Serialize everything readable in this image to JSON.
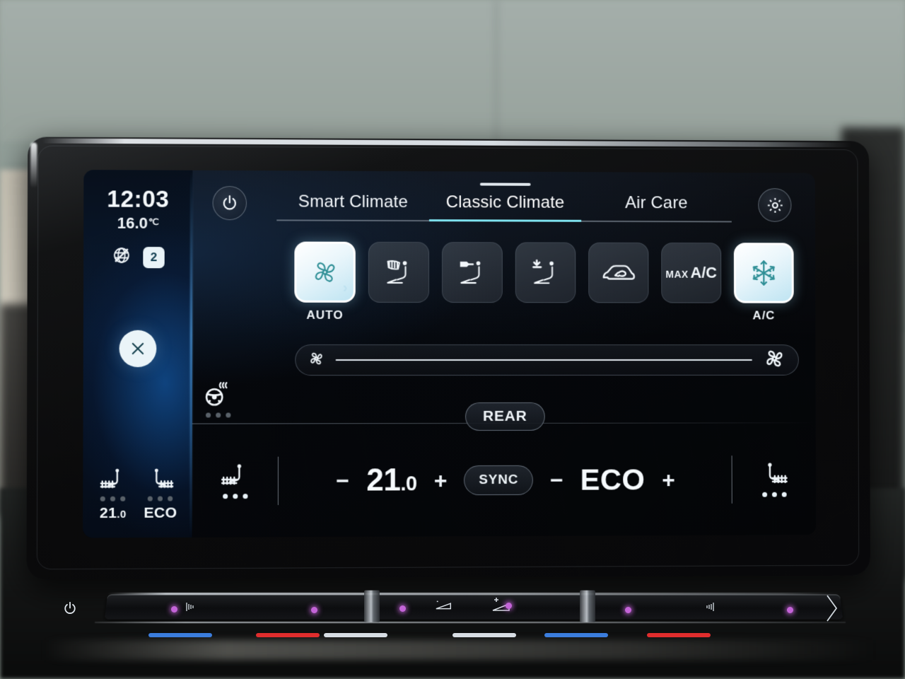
{
  "sidebar": {
    "clock": "12:03",
    "outside_temp": "16.0",
    "temp_unit": "℃",
    "connectivity_icon": "globe-no-connection-icon",
    "profile_badge": "2",
    "close_icon": "close-icon",
    "seats": [
      {
        "icon": "seat-heater-left-icon",
        "label": "21.0",
        "level_dots": 3,
        "active_dots": 0
      },
      {
        "icon": "seat-heater-right-icon",
        "label": "ECO",
        "level_dots": 3,
        "active_dots": 0
      }
    ]
  },
  "topbar": {
    "power_icon": "power-icon",
    "settings_icon": "gear-icon",
    "tabs": [
      {
        "label": "Smart Climate",
        "active": false
      },
      {
        "label": "Classic Climate",
        "active": true
      },
      {
        "label": "Air Care",
        "active": false
      }
    ]
  },
  "modes": [
    {
      "id": "auto",
      "icon": "fan-auto-icon",
      "label": "AUTO",
      "active": true,
      "chevron": "›"
    },
    {
      "id": "defrost",
      "icon": "windshield-defrost-icon",
      "label": "",
      "active": false
    },
    {
      "id": "face-vent",
      "icon": "seat-face-vent-icon",
      "label": "",
      "active": false
    },
    {
      "id": "floor-vent",
      "icon": "seat-floor-vent-icon",
      "label": "",
      "active": false
    },
    {
      "id": "recirculate",
      "icon": "air-recirculation-icon",
      "label": "",
      "active": false
    },
    {
      "id": "max-ac",
      "icon": "max-ac-text",
      "label": "",
      "active": false,
      "text_small": "MAX",
      "text_large": "A/C"
    },
    {
      "id": "ac",
      "icon": "snowflake-icon",
      "label": "A/C",
      "active": true
    }
  ],
  "fan_slider": {
    "icon_low": "fan-small-icon",
    "icon_high": "fan-large-icon",
    "value_percent": 100
  },
  "bottom": {
    "rear_label": "REAR",
    "sync_label": "SYNC",
    "minus": "−",
    "plus": "+",
    "driver_temp": {
      "whole": "21",
      "decimal": ".0"
    },
    "passenger_mode": "ECO",
    "seat_left": {
      "icon": "seat-heater-left-icon",
      "level_dots": 3,
      "active_dots": 0
    },
    "seat_right": {
      "icon": "seat-heater-right-icon",
      "level_dots": 3,
      "active_dots": 0
    },
    "steering_wheel": {
      "icon": "steering-wheel-heater-icon",
      "level_dots": 3,
      "active_dots": 0
    }
  },
  "hardware_bar": {
    "power_icon": "power-icon",
    "volume_down_icon": "volume-down-icon",
    "volume_up_icon": "volume-up-icon",
    "strip_colors": [
      "#3b7ddd",
      "#e02d2d",
      "#d7dde3",
      "#d7dde3",
      "#3b7ddd",
      "#e02d2d"
    ],
    "led_color": "#c464d8"
  },
  "colors": {
    "accent_cyan": "#7fe3f0",
    "active_tile": "#eaf6fb",
    "screen_bg": "#05070b",
    "sidebar_glow": "#1460b4"
  }
}
